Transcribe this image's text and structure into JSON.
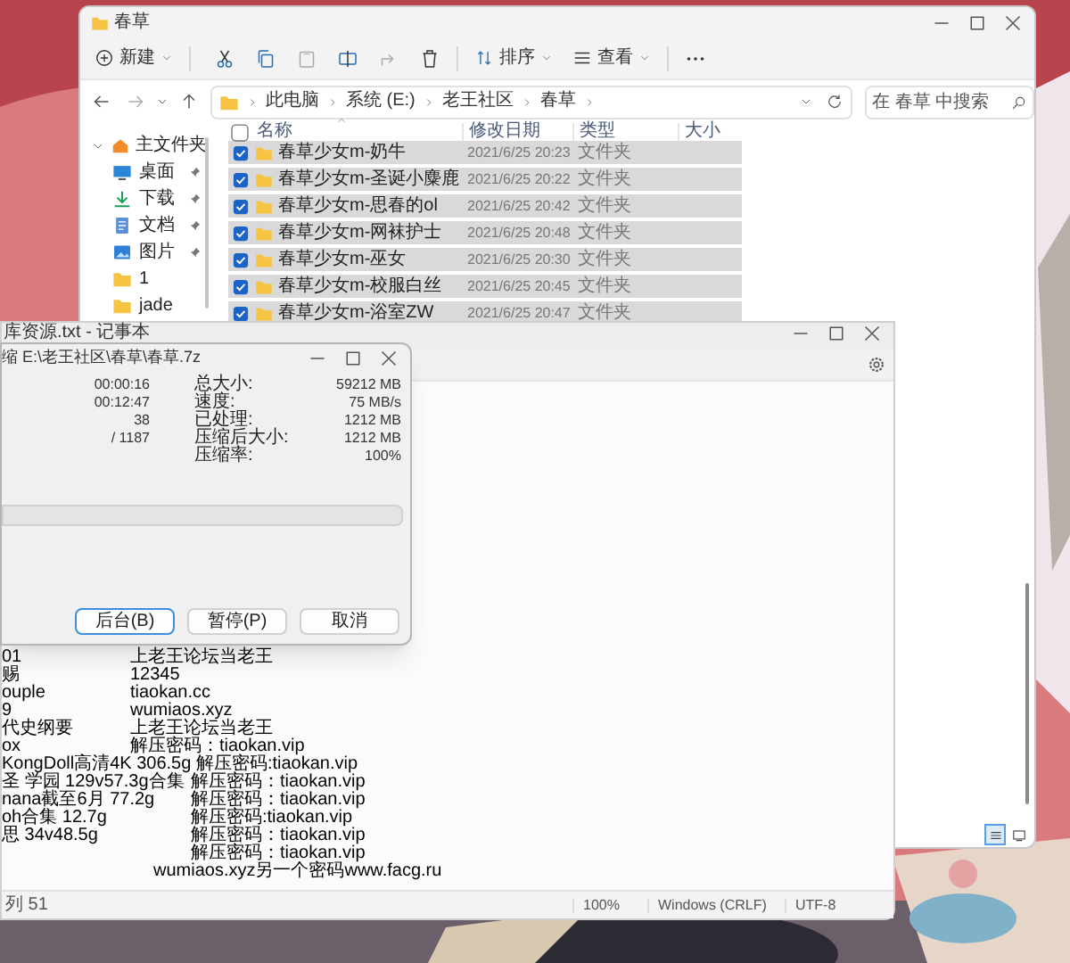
{
  "explorer": {
    "title": "春草",
    "toolbar": {
      "new": "新建",
      "sort": "排序",
      "view": "查看"
    },
    "breadcrumb": [
      "此电脑",
      "系统 (E:)",
      "老王社区",
      "春草"
    ],
    "search": {
      "placeholder": "在 春草 中搜索"
    },
    "nav": [
      {
        "label": "主文件夹",
        "kind": "home",
        "expanded": true,
        "children": [
          {
            "label": "桌面",
            "kind": "desktop",
            "pinned": true
          },
          {
            "label": "下载",
            "kind": "download",
            "pinned": true
          },
          {
            "label": "文档",
            "kind": "document",
            "pinned": true
          },
          {
            "label": "图片",
            "kind": "picture",
            "pinned": true
          },
          {
            "label": "1",
            "kind": "folder",
            "pinned": false
          },
          {
            "label": "jade",
            "kind": "folder",
            "pinned": false
          }
        ]
      }
    ],
    "columns": [
      "名称",
      "修改日期",
      "类型",
      "大小"
    ],
    "select_all_checked": false,
    "rows": [
      {
        "name": "春草少女m-奶牛",
        "modified": "2021/6/25 20:23",
        "type": "文件夹",
        "selected": true
      },
      {
        "name": "春草少女m-圣诞小麋鹿",
        "modified": "2021/6/25 20:22",
        "type": "文件夹",
        "selected": true
      },
      {
        "name": "春草少女m-思春的ol",
        "modified": "2021/6/25 20:42",
        "type": "文件夹",
        "selected": true
      },
      {
        "name": "春草少女m-网袜护士",
        "modified": "2021/6/25 20:48",
        "type": "文件夹",
        "selected": true
      },
      {
        "name": "春草少女m-巫女",
        "modified": "2021/6/25 20:30",
        "type": "文件夹",
        "selected": true
      },
      {
        "name": "春草少女m-校服白丝",
        "modified": "2021/6/25 20:45",
        "type": "文件夹",
        "selected": true
      },
      {
        "name": "春草少女m-浴室ZW",
        "modified": "2021/6/25 20:47",
        "type": "文件夹",
        "selected": true
      }
    ],
    "view_modes": [
      {
        "kind": "details",
        "selected": true
      },
      {
        "kind": "tiles",
        "selected": false
      }
    ]
  },
  "notepad": {
    "title": "库资源.txt - 记事本",
    "lines": [
      {
        "kind": "near",
        "lead": "01",
        "note": "上老王论坛当老王"
      },
      {
        "kind": "near",
        "lead": "赐",
        "note": "12345"
      },
      {
        "kind": "near",
        "lead": "ouple",
        "note": "tiaokan.cc"
      },
      {
        "kind": "near",
        "lead": "9",
        "note": "wumiaos.xyz"
      },
      {
        "kind": "near",
        "lead": "代史纲要",
        "note": "上老王论坛当老王"
      },
      {
        "kind": "near",
        "lead": "ox",
        "note": "解压密码：tiaokan.vip"
      },
      {
        "kind": "single",
        "text": "KongDoll高清4K 306.5g 解压密码:tiaokan.vip"
      },
      {
        "kind": "far",
        "lead": "圣 学园 129v57.3g合集",
        "note": "解压密码：tiaokan.vip"
      },
      {
        "kind": "far",
        "lead": "nana截至6月 77.2g",
        "note": "解压密码：tiaokan.vip"
      },
      {
        "kind": "far",
        "lead": "oh合集 12.7g",
        "note": "解压密码:tiaokan.vip"
      },
      {
        "kind": "far",
        "lead": "思 34v48.5g",
        "note": "解压密码：tiaokan.vip"
      },
      {
        "kind": "far",
        "note": "解压密码：tiaokan.vip"
      },
      {
        "kind": "mid",
        "note": "wumiaos.xyz另一个密码www.facg.ru"
      }
    ],
    "status": [
      "列 51",
      "100%",
      "Windows (CRLF)",
      "UTF-8"
    ]
  },
  "zip_dialog": {
    "title": "缩 E:\\老王社区\\春草\\春草.7z",
    "times": [
      "00:00:16",
      "00:12:47",
      "38",
      "/ 1187"
    ],
    "stats": [
      {
        "label": "总大小:",
        "value": "59212 MB"
      },
      {
        "label": "速度:",
        "value": "75 MB/s"
      },
      {
        "label": "已处理:",
        "value": "1212 MB"
      },
      {
        "label": "压缩后大小:",
        "value": "1212 MB"
      },
      {
        "label": "压缩率:",
        "value": "100%"
      }
    ],
    "progress": {
      "level": 0
    },
    "buttons": [
      {
        "label": "后台(B)",
        "focused": true
      },
      {
        "label": "暂停(P)",
        "focused": false
      },
      {
        "label": "取消",
        "focused": false
      }
    ]
  }
}
